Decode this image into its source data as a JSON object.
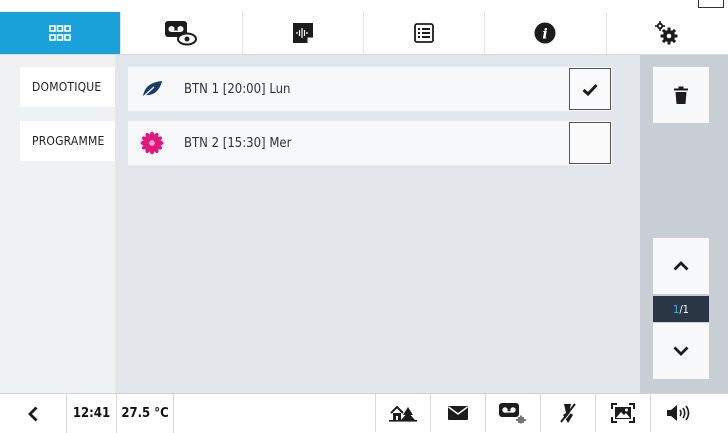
{
  "tabs": [
    {
      "icon": "grid-icon",
      "active": true
    },
    {
      "icon": "voicemail-view-icon",
      "active": false
    },
    {
      "icon": "audio-file-icon",
      "active": false
    },
    {
      "icon": "list-icon",
      "active": false
    },
    {
      "icon": "info-icon",
      "active": false
    },
    {
      "icon": "settings-gears-icon",
      "active": false
    }
  ],
  "left_nav": {
    "domotique_label": "DOMOTIQUE",
    "programme_label": "PROGRAMME"
  },
  "rows": [
    {
      "icon": "leaf-icon",
      "label": "BTN 1 [20:00] Lun",
      "checked": true
    },
    {
      "icon": "flower-icon",
      "label": "BTN 2 [15:30] Mer",
      "checked": false
    }
  ],
  "pager": {
    "current": "1",
    "separator": "/",
    "total": "1"
  },
  "status": {
    "time": "12:41",
    "temperature": "27.5 °C",
    "icons": [
      "home-icon",
      "mail-icon",
      "voicemail-audio-icon",
      "mute-icon",
      "image-frame-icon",
      "volume-icon"
    ]
  },
  "colors": {
    "accent": "#1aa1d9",
    "pager_bg": "#2a3744",
    "pager_current": "#38b6f0",
    "flower": "#e0197e",
    "leaf": "#1e3a66"
  }
}
